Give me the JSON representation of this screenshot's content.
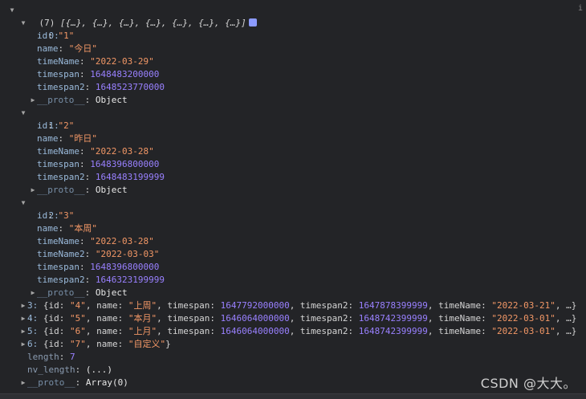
{
  "header": {
    "count": "(7)",
    "preview": "[{…}, {…}, {…}, {…}, {…}, {…}, {…}]",
    "right_marker": "i"
  },
  "items": [
    {
      "index": "0:",
      "id_key": "id",
      "id_val": "\"1\"",
      "name_key": "name",
      "name_q1": "\"",
      "name_val": "今日",
      "name_q2": "\"",
      "f3_key": "timeName",
      "f3_val": "\"2022-03-29\"",
      "f4_key": "timespan",
      "f4_val": "1648483200000",
      "f5_key": "timespan2",
      "f5_val": "1648523770000",
      "proto_key": "__proto__",
      "proto_val": "Object"
    },
    {
      "index": "1:",
      "id_key": "id",
      "id_val": "\"2\"",
      "name_key": "name",
      "name_q1": "\"",
      "name_val": "昨日",
      "name_q2": "\"",
      "f3_key": "timeName",
      "f3_val": "\"2022-03-28\"",
      "f4_key": "timespan",
      "f4_val": "1648396800000",
      "f5_key": "timespan2",
      "f5_val": "1648483199999",
      "proto_key": "__proto__",
      "proto_val": "Object"
    },
    {
      "index": "2:",
      "id_key": "id",
      "id_val": "\"3\"",
      "name_key": "name",
      "name_q1": "\"",
      "name_val": "本周",
      "name_q2": "\"",
      "f3_key": "timeName",
      "f3_val": "\"2022-03-28\"",
      "f3b_key": "timeName2",
      "f3b_val": "\"2022-03-03\"",
      "f4_key": "timespan",
      "f4_val": "1648396800000",
      "f5_key": "timespan2",
      "f5_val": "1646323199999",
      "proto_key": "__proto__",
      "proto_val": "Object"
    }
  ],
  "collapsed": [
    {
      "index": "3:",
      "p1": " {id: ",
      "id": "\"4\"",
      "p2": ", name: ",
      "nq1": "\"",
      "name": "上周",
      "nq2": "\"",
      "p3": ", timespan: ",
      "ts": "1647792000000",
      "p4": ", timespan2: ",
      "ts2": "1647878399999",
      "p5": ", timeName: ",
      "tn": "\"2022-03-21\"",
      "p6": ", …}"
    },
    {
      "index": "4:",
      "p1": " {id: ",
      "id": "\"5\"",
      "p2": ", name: ",
      "nq1": "\"",
      "name": "本月",
      "nq2": "\"",
      "p3": ", timespan: ",
      "ts": "1646064000000",
      "p4": ", timespan2: ",
      "ts2": "1648742399999",
      "p5": ", timeName: ",
      "tn": "\"2022-03-01\"",
      "p6": ", …}"
    },
    {
      "index": "5:",
      "p1": " {id: ",
      "id": "\"6\"",
      "p2": ", name: ",
      "nq1": "\"",
      "name": "上月",
      "nq2": "\"",
      "p3": ", timespan: ",
      "ts": "1646064000000",
      "p4": ", timespan2: ",
      "ts2": "1648742399999",
      "p5": ", timeName: ",
      "tn": "\"2022-03-01\"",
      "p6": ", …}"
    },
    {
      "index": "6:",
      "p1": " {id: ",
      "id": "\"7\"",
      "p2": ", name: ",
      "nq1": "\"",
      "name": "自定义",
      "nq2": "\"",
      "p6": "}"
    }
  ],
  "footer": {
    "length_key": "length",
    "length_val": "7",
    "nv_key": "nv_length",
    "nv_val": "(...)",
    "proto_key": "__proto__",
    "proto_val": "Array(0)"
  },
  "watermark": "CSDN @大大。"
}
